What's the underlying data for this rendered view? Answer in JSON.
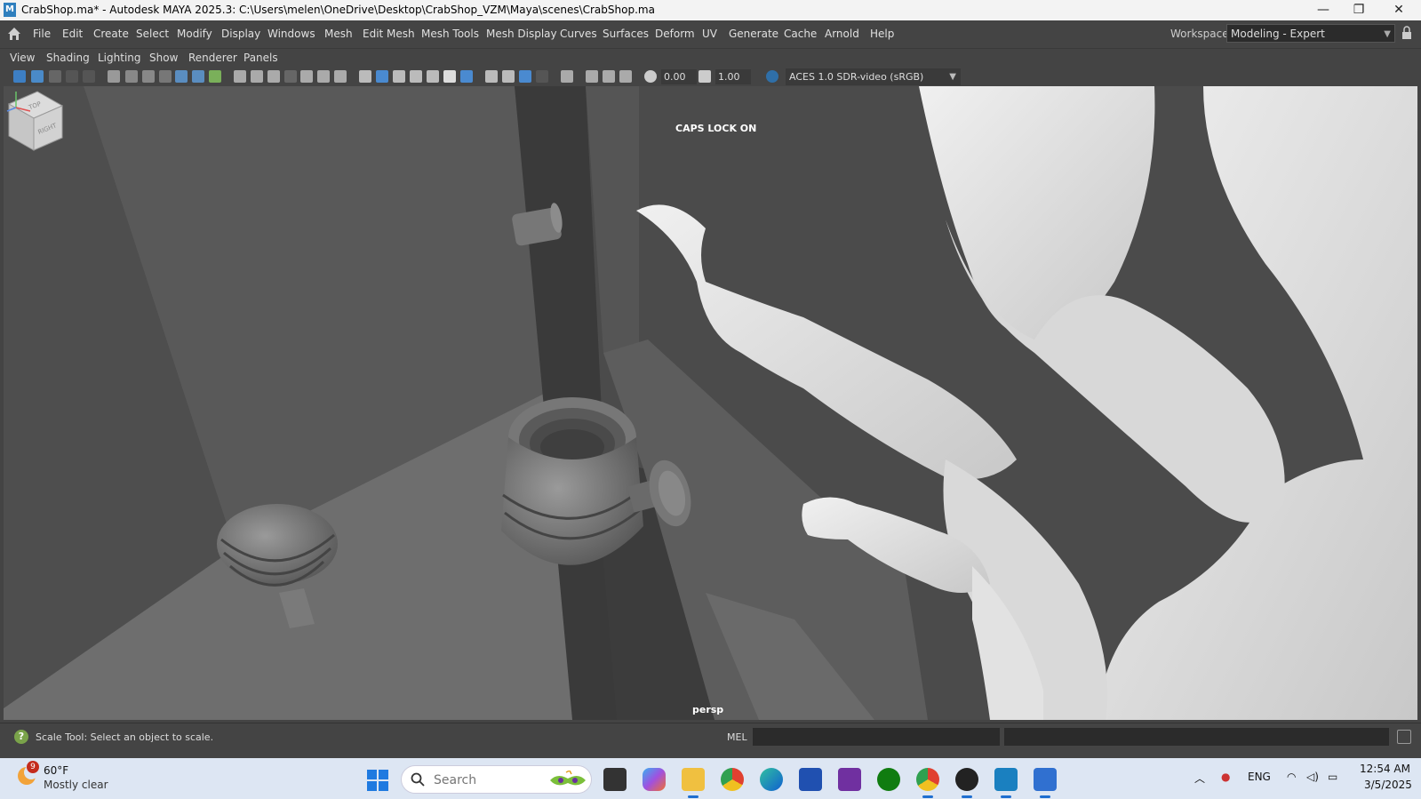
{
  "window": {
    "title": "CrabShop.ma* - Autodesk MAYA 2025.3: C:\\Users\\melen\\OneDrive\\Desktop\\CrabShop_VZM\\Maya\\scenes\\CrabShop.ma",
    "app_icon_letter": "M",
    "minimize_glyph": "—",
    "maximize_glyph": "❐",
    "close_glyph": "✕"
  },
  "main_menu": [
    "File",
    "Edit",
    "Create",
    "Select",
    "Modify",
    "Display",
    "Windows",
    "Mesh",
    "Edit Mesh",
    "Mesh Tools",
    "Mesh Display",
    "Curves",
    "Surfaces",
    "Deform",
    "UV",
    "Generate",
    "Cache",
    "Arnold",
    "Help"
  ],
  "workspace": {
    "label": "Workspace:",
    "value": "Modeling - Expert"
  },
  "panel_menu": [
    "View",
    "Shading",
    "Lighting",
    "Show",
    "Renderer",
    "Panels"
  ],
  "viewport_toolbar": {
    "exposure": "0.00",
    "gamma": "1.00",
    "color_space": "ACES 1.0 SDR-video (sRGB)"
  },
  "viewport": {
    "caps_lock_message": "CAPS LOCK ON",
    "camera_name": "persp",
    "viewcube_top": "TOP",
    "viewcube_right": "RIGHT"
  },
  "status_line": {
    "help_text": "Scale Tool: Select an object to scale.",
    "command_language": "MEL",
    "command_value": ""
  },
  "taskbar": {
    "weather_badge": "9",
    "weather_temp": "60°F",
    "weather_desc": "Mostly clear",
    "search_placeholder": "Search",
    "language": "ENG",
    "time": "12:54 AM",
    "date": "3/5/2025"
  },
  "colors": {
    "maya_blue": "#2f7fbe",
    "viewport_bg": "#4a4a4a",
    "ui_bg": "#444444",
    "taskbar_bg": "#dde6f3"
  }
}
